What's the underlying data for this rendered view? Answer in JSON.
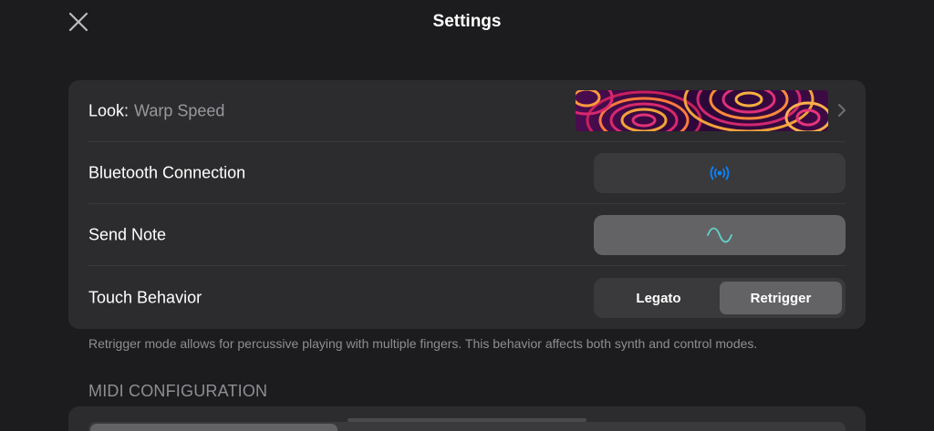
{
  "header": {
    "title": "Settings",
    "close_icon": "close-icon"
  },
  "settings": {
    "look": {
      "label": "Look:",
      "value": "Warp Speed",
      "chevron_icon": "chevron-right-icon"
    },
    "bluetooth": {
      "label": "Bluetooth Connection",
      "icon": "bluetooth-broadcast-icon",
      "icon_color": "#0a84ff"
    },
    "send_note": {
      "label": "Send Note",
      "icon": "sine-wave-icon",
      "icon_color": "#64d2c8"
    },
    "touch_behavior": {
      "label": "Touch Behavior",
      "options": [
        "Legato",
        "Retrigger"
      ],
      "selected": "Retrigger"
    }
  },
  "footnote": "Retrigger mode allows for percussive playing with multiple fingers. This behavior affects both synth and control modes.",
  "midi_section": {
    "header": "MIDI CONFIGURATION"
  },
  "colors": {
    "background": "#1c1c1e",
    "card": "#2c2c2e",
    "control": "#3a3a3c",
    "selected": "#636366",
    "secondary_text": "#8e8e93"
  }
}
